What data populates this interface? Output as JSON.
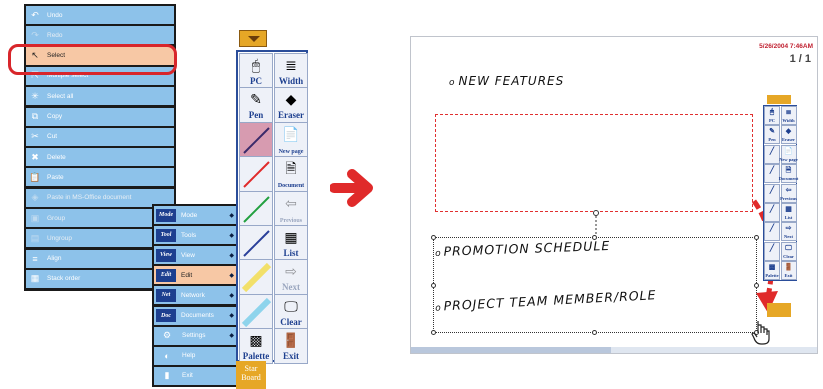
{
  "context_menu": {
    "items": [
      {
        "label": "Undo",
        "icon": "undo-icon",
        "glyph": "↶",
        "disabled": false,
        "submenu": false,
        "selected": false
      },
      {
        "label": "Redo",
        "icon": "redo-icon",
        "glyph": "↷",
        "disabled": true,
        "submenu": false,
        "selected": false
      },
      {
        "label": "Select",
        "icon": "select-arrow-icon",
        "glyph": "↖",
        "disabled": false,
        "submenu": false,
        "selected": true
      },
      {
        "label": "Multiple select",
        "icon": "multiple-select-icon",
        "glyph": "⇱",
        "disabled": false,
        "submenu": false,
        "selected": false
      },
      {
        "label": "Select all",
        "icon": "select-all-icon",
        "glyph": "✳",
        "disabled": false,
        "submenu": false,
        "selected": false
      },
      {
        "label": "Copy",
        "icon": "copy-icon",
        "glyph": "⧉",
        "disabled": false,
        "submenu": false,
        "selected": false
      },
      {
        "label": "Cut",
        "icon": "cut-icon",
        "glyph": "✂",
        "disabled": false,
        "submenu": false,
        "selected": false
      },
      {
        "label": "Delete",
        "icon": "delete-icon",
        "glyph": "✖",
        "disabled": false,
        "submenu": false,
        "selected": false
      },
      {
        "label": "Paste",
        "icon": "paste-icon",
        "glyph": "📋",
        "disabled": false,
        "submenu": false,
        "selected": false
      },
      {
        "label": "Paste in MS-Office document",
        "icon": "paste-office-icon",
        "glyph": "◈",
        "disabled": true,
        "submenu": false,
        "selected": false
      },
      {
        "label": "Group",
        "icon": "group-icon",
        "glyph": "▣",
        "disabled": true,
        "submenu": false,
        "selected": false
      },
      {
        "label": "Ungroup",
        "icon": "ungroup-icon",
        "glyph": "▤",
        "disabled": true,
        "submenu": false,
        "selected": false
      },
      {
        "label": "Align",
        "icon": "align-icon",
        "glyph": "≡",
        "disabled": false,
        "submenu": true,
        "selected": false
      },
      {
        "label": "Stack order",
        "icon": "stack-order-icon",
        "glyph": "▦",
        "disabled": false,
        "submenu": true,
        "selected": false
      }
    ]
  },
  "mode_menu": {
    "items": [
      {
        "label": "Mode",
        "tag": "Mode",
        "icon": "",
        "glyph": "",
        "submenu": true,
        "selected": false
      },
      {
        "label": "Tools",
        "tag": "Tool",
        "icon": "",
        "glyph": "",
        "submenu": true,
        "selected": false
      },
      {
        "label": "View",
        "tag": "View",
        "icon": "",
        "glyph": "",
        "submenu": true,
        "selected": false
      },
      {
        "label": "Edit",
        "tag": "Edit",
        "icon": "",
        "glyph": "",
        "submenu": true,
        "selected": true
      },
      {
        "label": "Network",
        "tag": "Net",
        "icon": "",
        "glyph": "",
        "submenu": true,
        "selected": false
      },
      {
        "label": "Documents",
        "tag": "Doc",
        "icon": "",
        "glyph": "",
        "submenu": true,
        "selected": false
      },
      {
        "label": "Settings",
        "tag": "",
        "icon": "settings-icon",
        "glyph": "⚙",
        "submenu": true,
        "selected": false
      },
      {
        "label": "Help",
        "tag": "",
        "icon": "help-globe-icon",
        "glyph": "◐",
        "submenu": false,
        "selected": false
      },
      {
        "label": "Exit",
        "tag": "",
        "icon": "exit-icon",
        "glyph": "▮",
        "submenu": false,
        "selected": false
      }
    ]
  },
  "toolbar": {
    "buttons": [
      {
        "label": "PC",
        "icon": "pc-mouse-icon",
        "glyph": "🖱",
        "disabled": false,
        "small": false
      },
      {
        "label": "Width",
        "icon": "width-icon",
        "glyph": "≣",
        "disabled": false,
        "small": false
      },
      {
        "label": "Pen",
        "icon": "pen-icon",
        "glyph": "✎",
        "disabled": false,
        "small": false
      },
      {
        "label": "Eraser",
        "icon": "eraser-icon",
        "glyph": "◆",
        "disabled": false,
        "small": false
      },
      {
        "label": "",
        "icon": "pen-color-purple-icon",
        "glyph": "",
        "disabled": false,
        "small": false
      },
      {
        "label": "New page",
        "icon": "new-page-icon",
        "glyph": "📄",
        "disabled": false,
        "small": true
      },
      {
        "label": "",
        "icon": "pen-color-red-icon",
        "glyph": "",
        "disabled": false,
        "small": false
      },
      {
        "label": "Document",
        "icon": "document-icon",
        "glyph": "🗎",
        "disabled": false,
        "small": true
      },
      {
        "label": "",
        "icon": "pen-color-green-icon",
        "glyph": "",
        "disabled": false,
        "small": false
      },
      {
        "label": "Previous",
        "icon": "previous-icon",
        "glyph": "⇦",
        "disabled": true,
        "small": true
      },
      {
        "label": "",
        "icon": "pen-color-blue-icon",
        "glyph": "",
        "disabled": false,
        "small": false
      },
      {
        "label": "List",
        "icon": "list-icon",
        "glyph": "▦",
        "disabled": false,
        "small": false
      },
      {
        "label": "",
        "icon": "highlighter-yellow-icon",
        "glyph": "",
        "disabled": false,
        "small": false
      },
      {
        "label": "Next",
        "icon": "next-icon",
        "glyph": "⇨",
        "disabled": true,
        "small": false
      },
      {
        "label": "",
        "icon": "highlighter-cyan-icon",
        "glyph": "",
        "disabled": false,
        "small": false
      },
      {
        "label": "Clear",
        "icon": "clear-icon",
        "glyph": "🖵",
        "disabled": false,
        "small": false
      },
      {
        "label": "Palette",
        "icon": "palette-icon",
        "glyph": "▩",
        "disabled": false,
        "small": false
      },
      {
        "label": "Exit",
        "icon": "exit-door-icon",
        "glyph": "🚪",
        "disabled": false,
        "small": false
      }
    ],
    "star_label_1": "Star",
    "star_label_2": "Board"
  },
  "board": {
    "timestamp": "5/26/2004 7:46AM",
    "page": "1 / 1",
    "line1": "NEW FEATURES",
    "line2": "PROMOTION SCHEDULE",
    "line3": "PROJECT TEAM MEMBER/ROLE"
  },
  "mini_toolbar": {
    "buttons": [
      {
        "label": "PC",
        "glyph": "🖱"
      },
      {
        "label": "Width",
        "glyph": "≣"
      },
      {
        "label": "Pen",
        "glyph": "✎"
      },
      {
        "label": "Eraser",
        "glyph": "◆"
      },
      {
        "label": "",
        "glyph": "╱"
      },
      {
        "label": "New page",
        "glyph": "📄"
      },
      {
        "label": "",
        "glyph": "╱"
      },
      {
        "label": "Document",
        "glyph": "🗎"
      },
      {
        "label": "",
        "glyph": "╱"
      },
      {
        "label": "Previous",
        "glyph": "⇦"
      },
      {
        "label": "",
        "glyph": "╱"
      },
      {
        "label": "List",
        "glyph": "▦"
      },
      {
        "label": "",
        "glyph": "╱"
      },
      {
        "label": "Next",
        "glyph": "⇨"
      },
      {
        "label": "",
        "glyph": "╱"
      },
      {
        "label": "Clear",
        "glyph": "🖵"
      },
      {
        "label": "Palette",
        "glyph": "▩"
      },
      {
        "label": "Exit",
        "glyph": "🚪"
      }
    ]
  },
  "colors": {
    "menu_item": "#8dc2ea",
    "selected_item": "#f7c8a5",
    "highlight_ring": "#d8262b",
    "toolbar_border": "#2a4d9a",
    "accent_orange": "#e6a726",
    "arrow_red": "#e02a2a"
  }
}
